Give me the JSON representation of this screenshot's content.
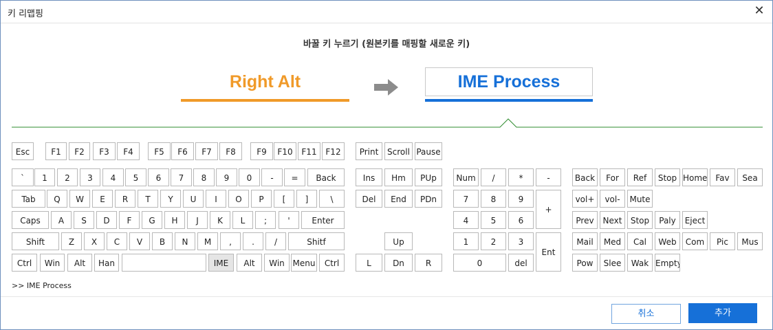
{
  "window": {
    "title": "키 리맵핑",
    "close_glyph": "✕"
  },
  "instruction": "바꿀 키 누르기 (원본키를 매핑할 새로운 키)",
  "mapping": {
    "source_key": "Right Alt",
    "target_key": "IME Process"
  },
  "status_text": ">>  IME Process",
  "footer": {
    "cancel_label": "취소",
    "add_label": "추가"
  },
  "colors": {
    "source_accent": "#f09a29",
    "target_accent": "#1670d8",
    "divider": "#2e8b2e",
    "highlight_key": "#e5e5e5"
  },
  "highlighted_key": "IME",
  "keyboard": {
    "main": [
      [
        "Esc",
        "F1",
        "F2",
        "F3",
        "F4",
        "F5",
        "F6",
        "F7",
        "F8",
        "F9",
        "F10",
        "F11",
        "F12"
      ],
      [
        "`",
        "1",
        "2",
        "3",
        "4",
        "5",
        "6",
        "7",
        "8",
        "9",
        "0",
        "-",
        "=",
        "Back"
      ],
      [
        "Tab",
        "Q",
        "W",
        "E",
        "R",
        "T",
        "Y",
        "U",
        "I",
        "O",
        "P",
        "[",
        "]",
        "\\"
      ],
      [
        "Caps",
        "A",
        "S",
        "D",
        "F",
        "G",
        "H",
        "J",
        "K",
        "L",
        ";",
        "'",
        "Enter"
      ],
      [
        "Shift",
        "Z",
        "X",
        "C",
        "V",
        "B",
        "N",
        "M",
        ",",
        ".",
        "/",
        "Shitf"
      ],
      [
        "Ctrl",
        "Win",
        "Alt",
        "Han",
        "",
        "IME",
        "Alt",
        "Win",
        "Menu",
        "Ctrl"
      ]
    ],
    "nav": [
      [
        "Print",
        "Scroll",
        "Pause"
      ],
      [
        "Ins",
        "Hm",
        "PUp"
      ],
      [
        "Del",
        "End",
        "PDn"
      ],
      [
        "Up"
      ],
      [
        "L",
        "Dn",
        "R"
      ]
    ],
    "numpad": [
      [
        "Num",
        "/",
        "*",
        "-"
      ],
      [
        "7",
        "8",
        "9",
        "+"
      ],
      [
        "4",
        "5",
        "6"
      ],
      [
        "1",
        "2",
        "3",
        "Ent"
      ],
      [
        "0",
        "del"
      ]
    ],
    "media": [
      [
        "Back",
        "For",
        "Ref",
        "Stop",
        "Home",
        "Fav",
        "Sea"
      ],
      [
        "vol+",
        "vol-",
        "Mute"
      ],
      [
        "Prev",
        "Next",
        "Stop",
        "Paly",
        "Eject"
      ],
      [
        "Mail",
        "Med",
        "Cal",
        "Web",
        "Com",
        "Pic",
        "Mus"
      ],
      [
        "Pow",
        "Slee",
        "Wak",
        "Empty"
      ]
    ]
  }
}
